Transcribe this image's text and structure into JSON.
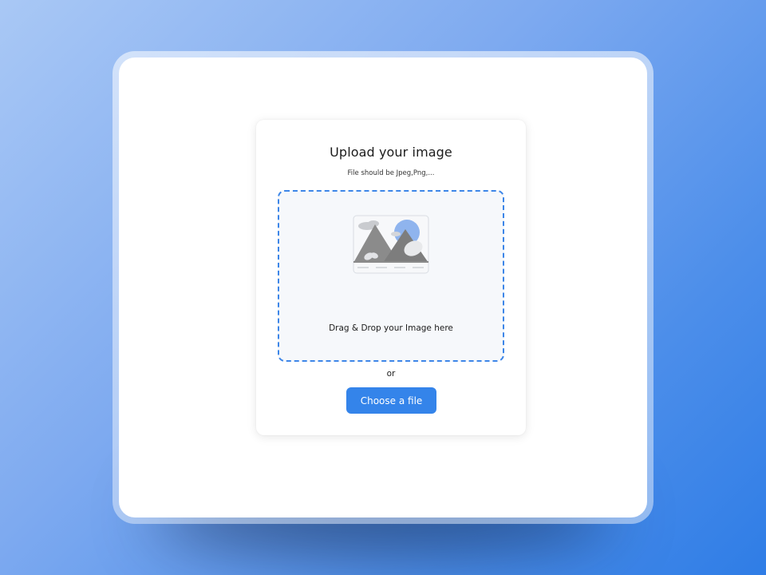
{
  "upload": {
    "title": "Upload your image",
    "subtitle": "File should be Jpeg,Png,...",
    "dropzone_text": "Drag & Drop your Image here",
    "separator_text": "or",
    "choose_button_label": "Choose a file",
    "illustration_icon": "image-placeholder-icon"
  },
  "colors": {
    "accent": "#3484ea",
    "dropzone_border": "#3d86e8",
    "dropzone_background": "#f6f8fb"
  }
}
